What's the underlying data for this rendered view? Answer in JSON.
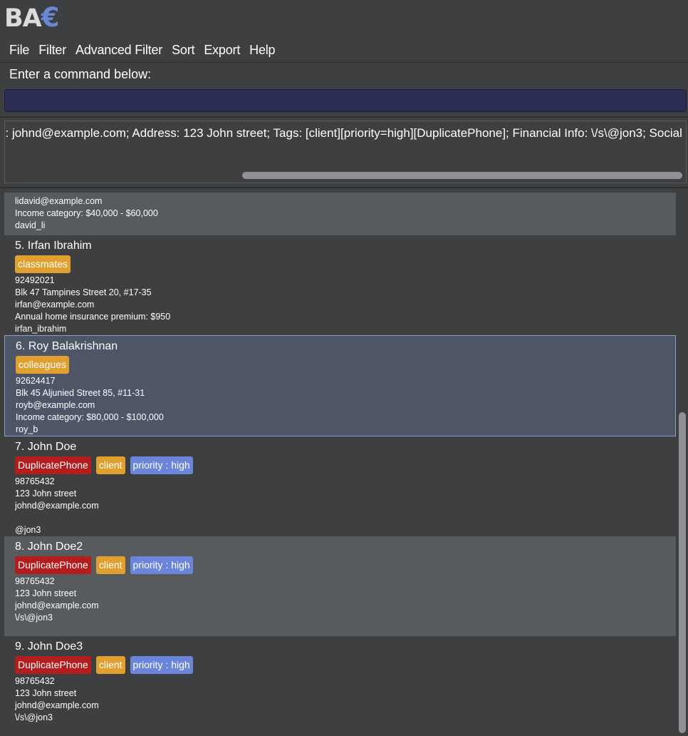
{
  "app": {
    "logo_main": "BA",
    "logo_symbol": "€"
  },
  "menu": {
    "items": [
      {
        "label": "File"
      },
      {
        "label": "Filter"
      },
      {
        "label": "Advanced Filter"
      },
      {
        "label": "Sort"
      },
      {
        "label": "Export"
      },
      {
        "label": "Help"
      }
    ]
  },
  "command": {
    "label": "Enter a command below:",
    "value": "",
    "placeholder": ""
  },
  "result": {
    "text": "Email: johnd@example.com; Address: 123 John street; Tags: [client][priority=high][DuplicatePhone]; Financial Info: \\/s\\@jon3; Social Media Handle:"
  },
  "persons": [
    {
      "name": "",
      "tags": [],
      "lines": [
        "lidavid@example.com",
        "Income category: $40,000 - $60,000",
        "david_li"
      ]
    },
    {
      "name": "5. Irfan Ibrahim",
      "tags": [
        {
          "label": "classmates",
          "color": "#dfa030"
        }
      ],
      "lines": [
        "92492021",
        "Blk 47 Tampines Street 20, #17-35",
        "irfan@example.com",
        "Annual home insurance premium: $950",
        "irfan_ibrahim"
      ]
    },
    {
      "name": "6. Roy Balakrishnan",
      "tags": [
        {
          "label": "colleagues",
          "color": "#dfa030"
        }
      ],
      "lines": [
        "92624417",
        "Blk 45 Aljunied Street 85, #11-31",
        "royb@example.com",
        "Income category: $80,000 - $100,000",
        "roy_b"
      ]
    },
    {
      "name": "7. John Doe",
      "tags": [
        {
          "label": "DuplicatePhone",
          "color": "#b31d1d"
        },
        {
          "label": "client",
          "color": "#dfa030"
        },
        {
          "label": "priority : high",
          "color": "#6a85d9"
        }
      ],
      "lines": [
        "98765432",
        "123 John street",
        "johnd@example.com",
        "",
        "@jon3"
      ]
    },
    {
      "name": "8. John Doe2",
      "tags": [
        {
          "label": "DuplicatePhone",
          "color": "#b31d1d"
        },
        {
          "label": "client",
          "color": "#dfa030"
        },
        {
          "label": "priority : high",
          "color": "#6a85d9"
        }
      ],
      "lines": [
        "98765432",
        "123 John street",
        "johnd@example.com",
        "\\/s\\@jon3"
      ]
    },
    {
      "name": "9. John Doe3",
      "tags": [
        {
          "label": "DuplicatePhone",
          "color": "#b31d1d"
        },
        {
          "label": "client",
          "color": "#dfa030"
        },
        {
          "label": "priority : high",
          "color": "#6a85d9"
        }
      ],
      "lines": [
        "98765432",
        "123 John street",
        "johnd@example.com",
        "\\/s\\@jon3"
      ]
    }
  ],
  "selected_person": "6. Roy Balakrishnan"
}
